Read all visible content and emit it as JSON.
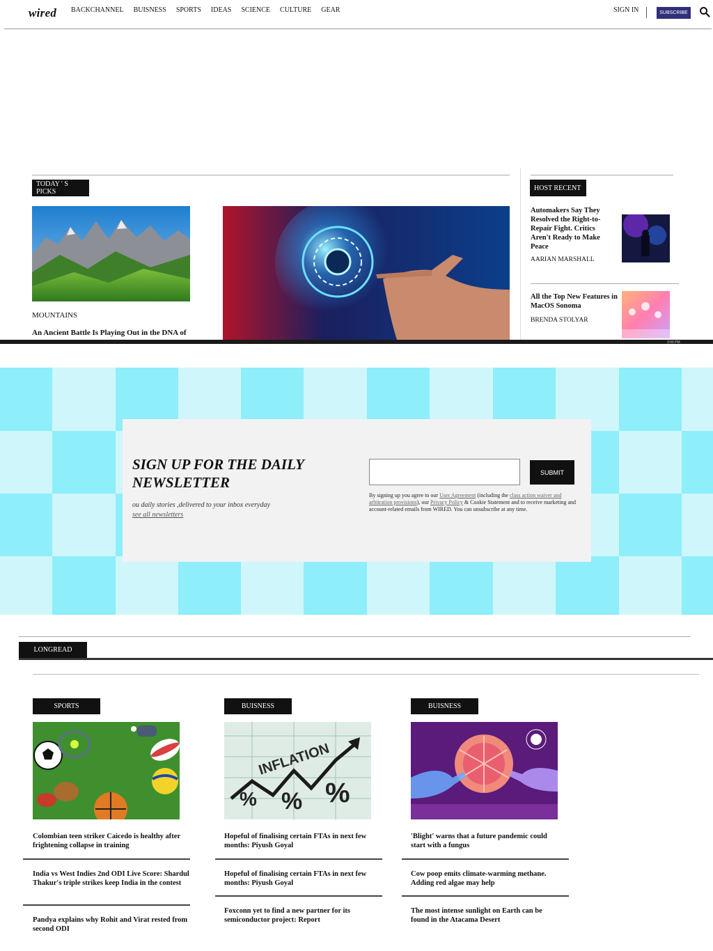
{
  "header": {
    "logo": "wired",
    "nav": [
      "BACKCHANNEL",
      "BUISNESS",
      "SPORTS",
      "IDEAS",
      "SCIENCE",
      "CULTURE",
      "GEAR"
    ],
    "sign_in": "SIGN IN",
    "subscribe": "SUBSCRIBE",
    "search_icon": "search-icon"
  },
  "todays_picks": {
    "label": "TODAY ' S PICKS",
    "card1": {
      "kicker": "MOUNTAINS",
      "title": "An Ancient Battle Is Playing Out in the DNA of"
    }
  },
  "most_recent": {
    "label": "HOST RECENT",
    "items": [
      {
        "title": "Automakers Say They Resolved the Right-to-Repair Fight. Critics Aren't Ready to Make Peace",
        "author": "AARIAN MARSHALL"
      },
      {
        "title": "All the Top New Features in MacOS Sonoma",
        "author": "BRENDA STOLYAR"
      }
    ]
  },
  "taskbar_time": "3:00 PM",
  "newsletter": {
    "title": "SIGN UP FOR THE DAILY NEWSLETTER",
    "subtitle": "ou daily stories ,delivered to your inbox everyday",
    "link": "see all newsletters",
    "submit": "SUBMIT",
    "legal": {
      "p1": "By signing up you agree to our ",
      "user_agreement": "User Agreement",
      "p2": " (including the ",
      "class_action": "class action waiver and arbitration provisions",
      "p3": "), our ",
      "privacy": "Privacy Policy",
      "p4": " & Cookie Statement and to receive marketing and account-related emails from WIRED. You can unsubscribe at any time."
    }
  },
  "longread": {
    "label": "LONGREAD",
    "columns": [
      {
        "tag": "SPORTS",
        "articles": [
          "Colombian teen striker Caicedo is healthy after frightening collapse in training",
          "India vs West Indies 2nd ODI Live Score: Shardul Thakur's triple strikes keep India in the contest",
          "Pandya explains why Rohit and Virat rested from second ODI"
        ]
      },
      {
        "tag": "BUISNESS",
        "image_text": "INFLATION",
        "articles": [
          "Hopeful of finalising certain FTAs in next few months: Piyush Goyal",
          "Hopeful of finalising certain FTAs in next few months: Piyush Goyal",
          "Foxconn yet to find a new partner for its semiconductor project: Report"
        ]
      },
      {
        "tag": "BUISNESS",
        "articles": [
          "'Blight' warns that a future pandemic could start with a fungus",
          "Cow poop emits climate-warming methane. Adding red algae may help",
          "The most intense sunlight on Earth can be found in the Atacama Desert"
        ]
      }
    ]
  }
}
